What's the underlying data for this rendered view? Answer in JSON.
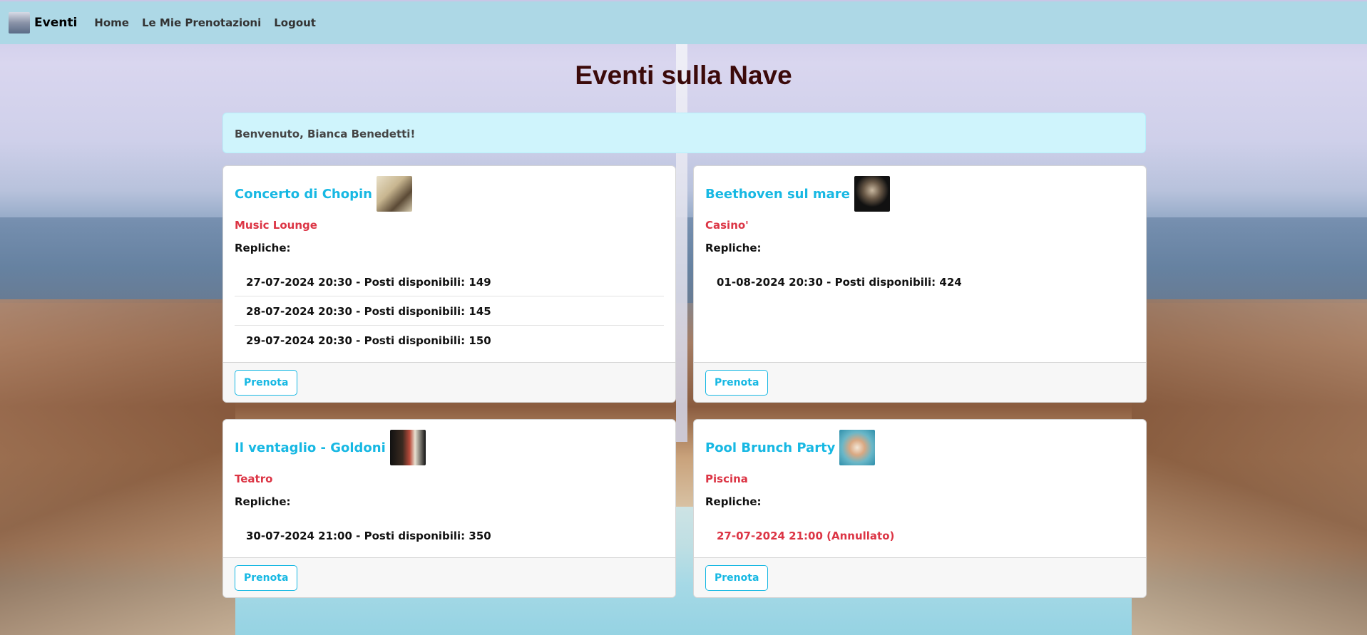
{
  "navbar": {
    "brand": "Eventi",
    "links": [
      "Home",
      "Le Mie Prenotazioni",
      "Logout"
    ]
  },
  "page_title": "Eventi sulla Nave",
  "welcome": "Benvenuto, Bianca Benedetti!",
  "colors": {
    "navbar": "#add8e6",
    "accent": "#17b8e3",
    "venue": "#dc3545",
    "title": "#3b0a0a",
    "alert": "#cff4fc"
  },
  "replicas_label": "Repliche:",
  "book_label": "Prenota",
  "events": [
    {
      "title": "Concerto di Chopin",
      "venue": "Music Lounge",
      "performances": [
        {
          "text": "27-07-2024 20:30 - Posti disponibili: 149",
          "cancelled": false
        },
        {
          "text": "28-07-2024 20:30 - Posti disponibili: 145",
          "cancelled": false
        },
        {
          "text": "29-07-2024 20:30 - Posti disponibili: 150",
          "cancelled": false
        }
      ]
    },
    {
      "title": "Beethoven sul mare",
      "venue": "Casino'",
      "performances": [
        {
          "text": "01-08-2024 20:30 - Posti disponibili: 424",
          "cancelled": false
        }
      ]
    },
    {
      "title": "Il ventaglio - Goldoni",
      "venue": "Teatro",
      "performances": [
        {
          "text": "30-07-2024 21:00 - Posti disponibili: 350",
          "cancelled": false
        }
      ]
    },
    {
      "title": "Pool Brunch Party",
      "venue": "Piscina",
      "performances": [
        {
          "text": "27-07-2024 21:00 (Annullato)",
          "cancelled": true
        }
      ]
    }
  ]
}
